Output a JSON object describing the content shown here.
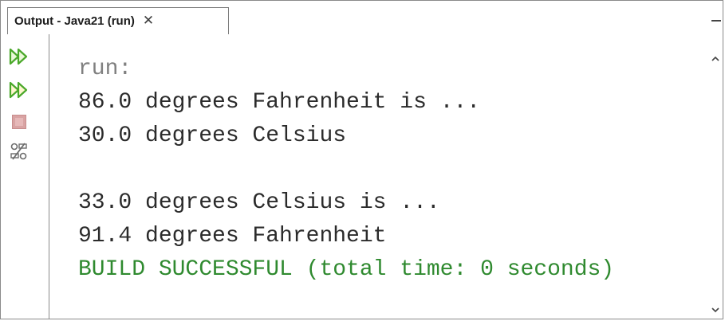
{
  "window": {
    "tab_label": "Output - Java21 (run)",
    "tab_close": "✕"
  },
  "toolbar": {
    "icons": [
      "rerun-icon",
      "rerun-with-options-icon",
      "stop-icon",
      "output-settings-icon"
    ]
  },
  "console": {
    "lines": [
      "run:",
      "86.0 degrees Fahrenheit is ...",
      "30.0 degrees Celsius",
      "",
      "33.0 degrees Celsius is ...",
      "91.4 degrees Fahrenheit",
      "BUILD SUCCESSFUL (total time: 0 seconds)"
    ]
  },
  "colors": {
    "run_icon": "#4aa82a",
    "stop_icon": "#d9a3a3",
    "meta_text": "#808080",
    "success_text": "#2f8a2f",
    "output_text": "#2b2b2b"
  }
}
